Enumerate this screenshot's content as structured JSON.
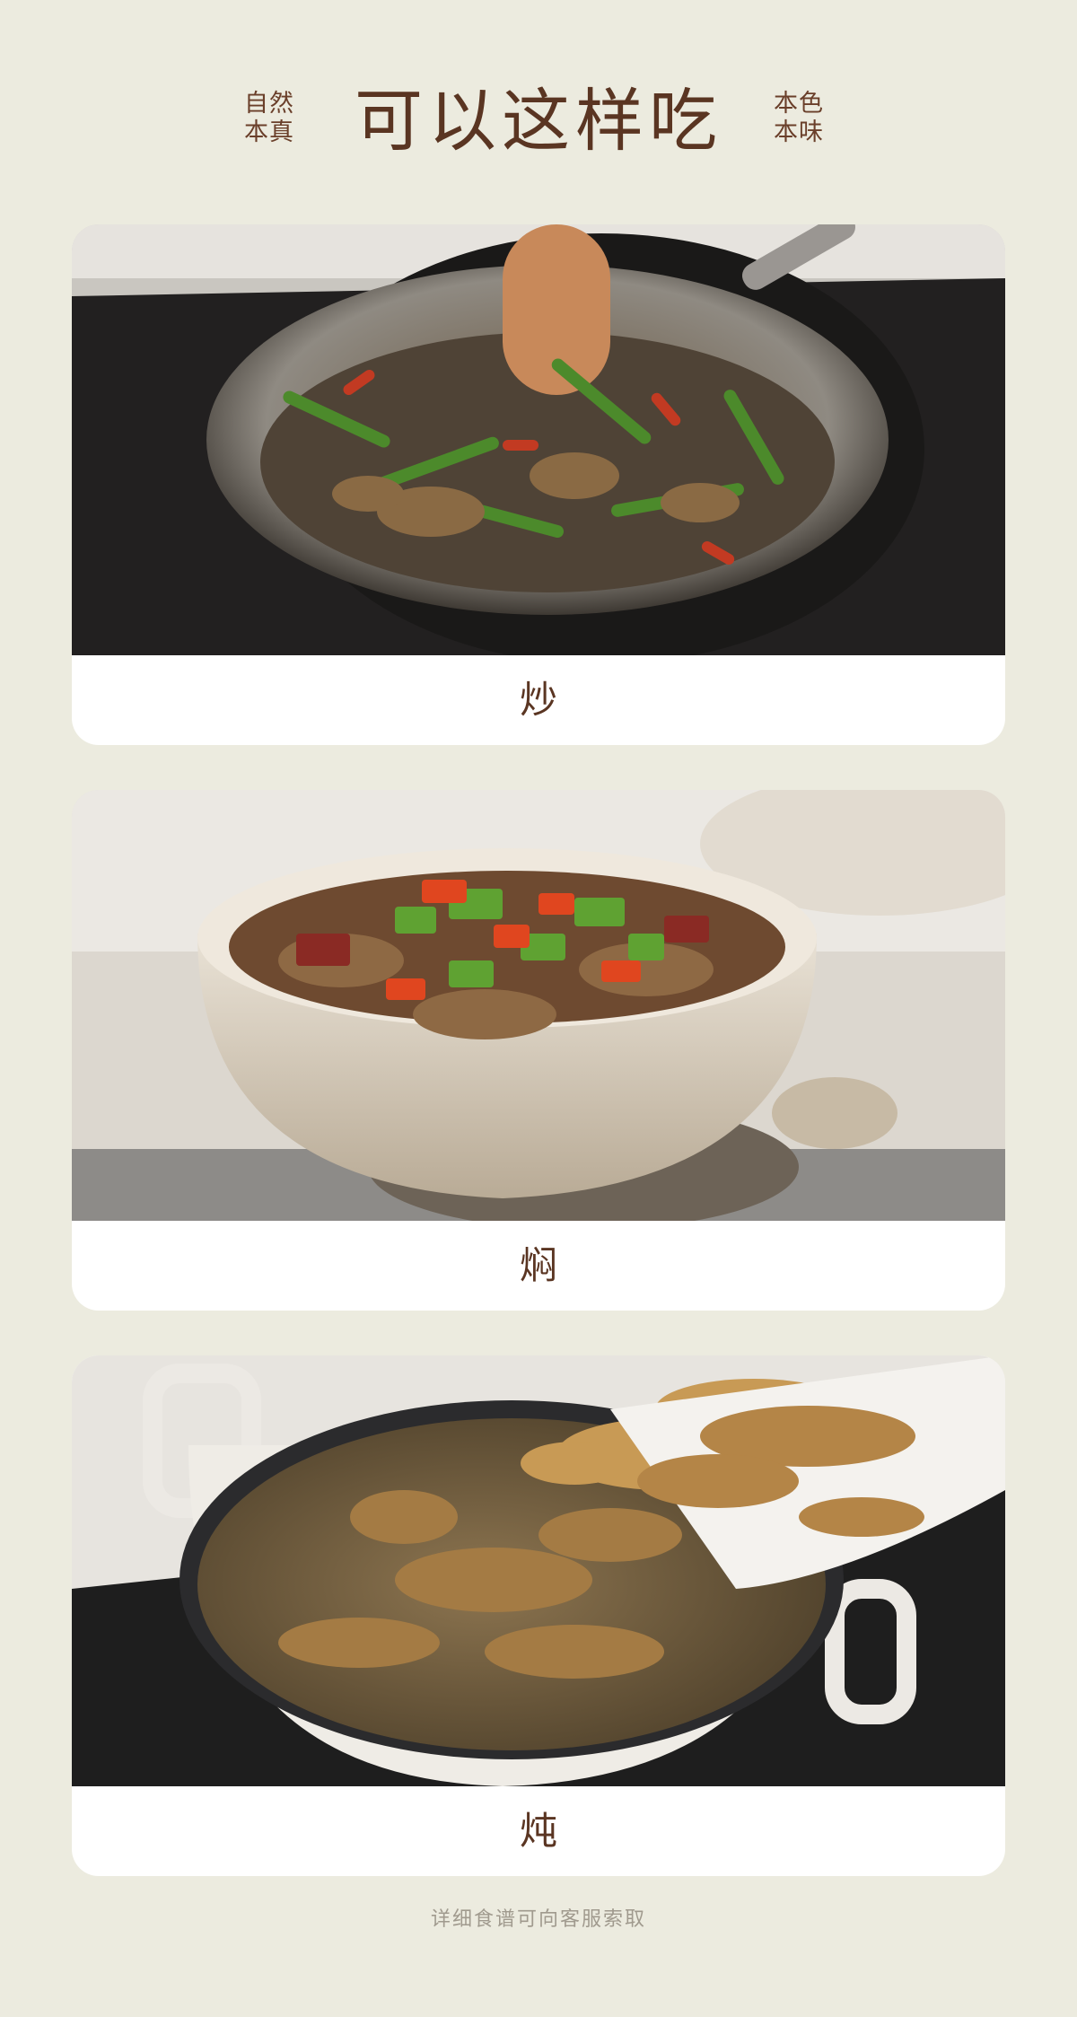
{
  "header": {
    "left_tag": [
      "自然",
      "本真"
    ],
    "title": "可以这样吃",
    "right_tag": [
      "本色",
      "本味"
    ]
  },
  "cards": [
    {
      "label": "炒",
      "photo": "stir-fry-pan-photo"
    },
    {
      "label": "焖",
      "photo": "clay-pot-braise-photo"
    },
    {
      "label": "炖",
      "photo": "stew-pot-photo"
    }
  ],
  "footer": {
    "note": "详细食谱可向客服索取"
  },
  "colors": {
    "page_bg": "#ecebdf",
    "card_bg": "#ffffff",
    "title_brown": "#5a3522",
    "footer_gray": "#a09a8e"
  }
}
